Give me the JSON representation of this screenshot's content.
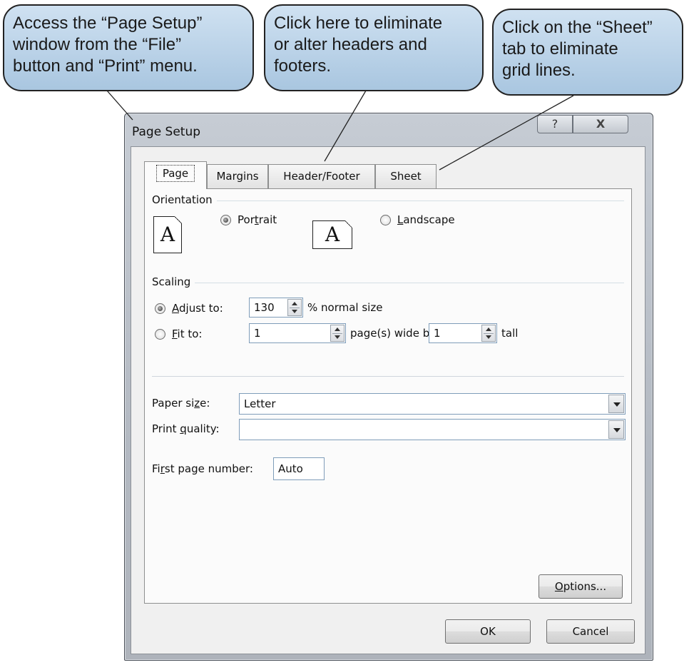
{
  "callouts": {
    "page_setup_access": "Access the “Page Setup”\nwindow from the “File”\nbutton and “Print” menu.",
    "header_footer": "Click here to eliminate\nor alter headers and\nfooters.",
    "sheet_tab": "Click on the “Sheet”\ntab to eliminate\ngrid lines."
  },
  "window": {
    "title": "Page Setup",
    "help_glyph": "?",
    "close_glyph": "X"
  },
  "tabs": [
    {
      "label": "Page",
      "active": true
    },
    {
      "label": "Margins",
      "active": false
    },
    {
      "label": "Header/Footer",
      "active": false
    },
    {
      "label": "Sheet",
      "active": false
    }
  ],
  "orientation": {
    "section_label": "Orientation",
    "icon_glyph": "A",
    "portrait": {
      "pre": "Por",
      "mn": "t",
      "post": "rait",
      "selected": true
    },
    "landscape": {
      "pre": "",
      "mn": "L",
      "post": "andscape",
      "selected": false
    }
  },
  "scaling": {
    "section_label": "Scaling",
    "adjust": {
      "mn": "A",
      "post": "djust to:",
      "selected": true,
      "value": "130",
      "suffix": "% normal size"
    },
    "fit": {
      "mn": "F",
      "post": "it to:",
      "selected": false,
      "wide_value": "1",
      "wide_suffix": "page(s) wide by",
      "tall_value": "1",
      "tall_suffix": "tall"
    }
  },
  "paper_size": {
    "pre": "Paper si",
    "mn": "z",
    "post": "e:",
    "value": "Letter"
  },
  "print_quality": {
    "pre": "Print ",
    "mn": "q",
    "post": "uality:",
    "value": ""
  },
  "first_page": {
    "pre": "Fi",
    "mn": "r",
    "post": "st page number:",
    "value": "Auto"
  },
  "buttons": {
    "options": {
      "mn": "O",
      "post": "ptions..."
    },
    "ok": "OK",
    "cancel": "Cancel"
  }
}
